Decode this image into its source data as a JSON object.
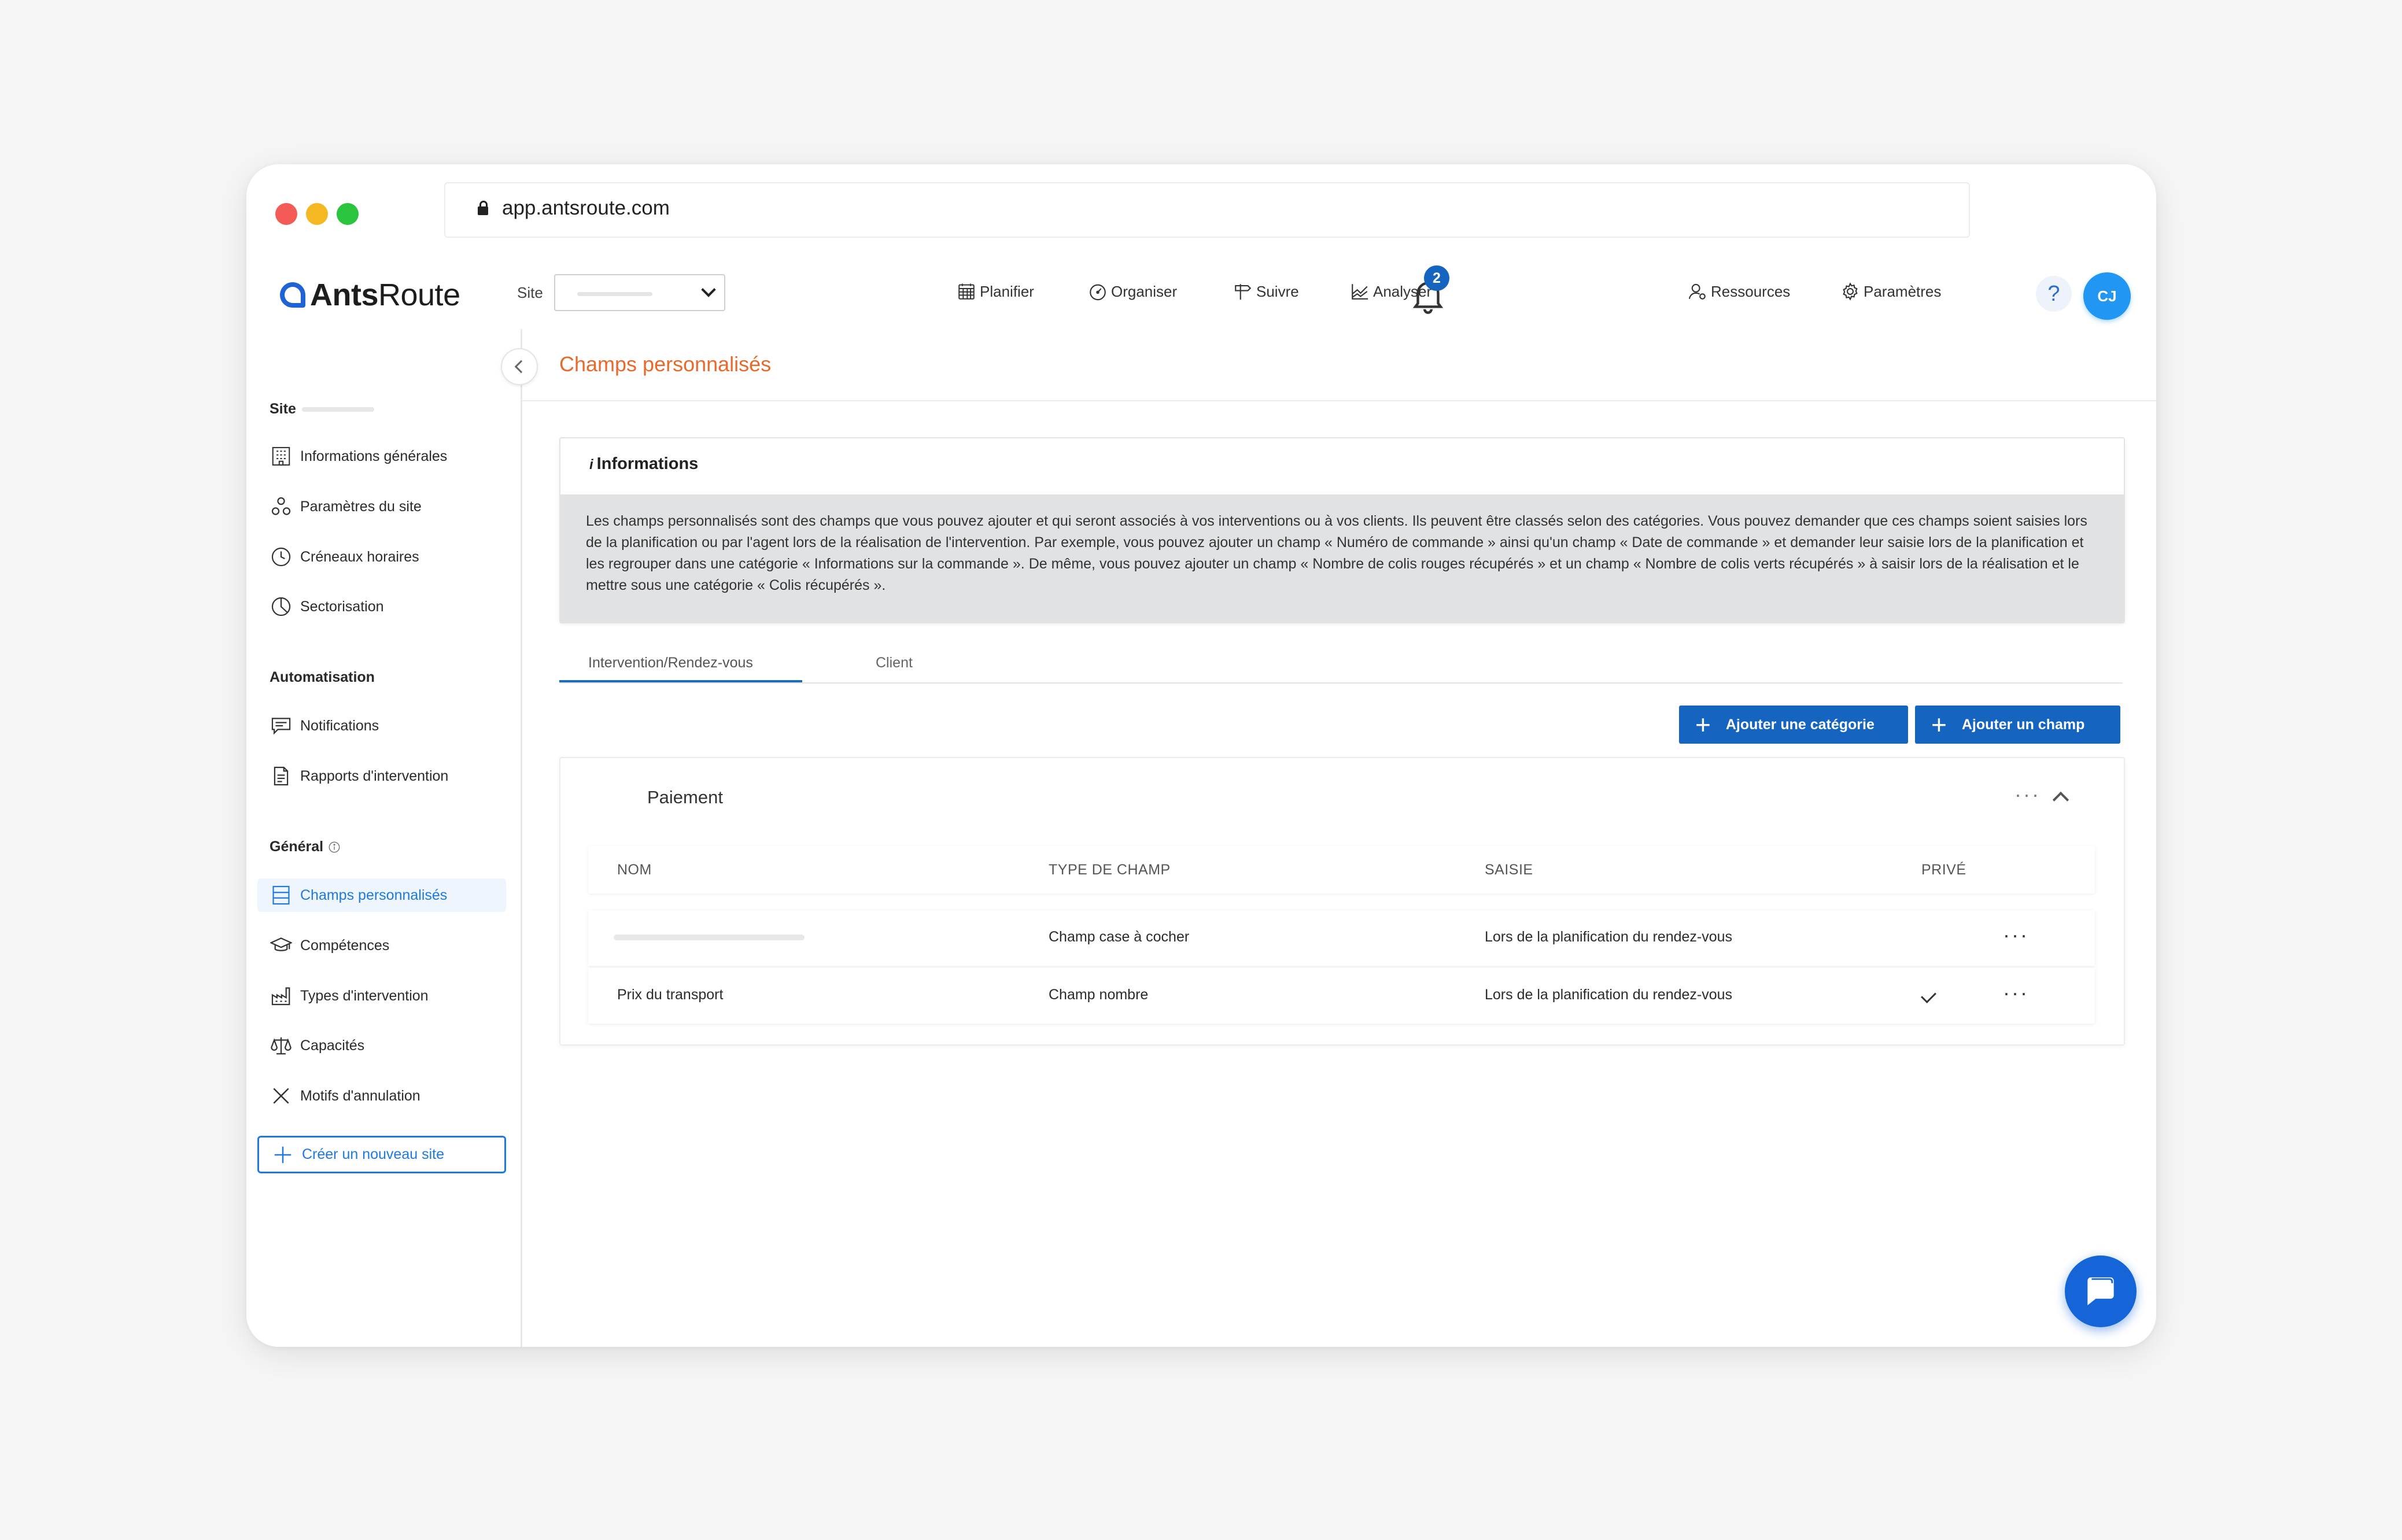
{
  "browser": {
    "url": "app.antsroute.com"
  },
  "navbar": {
    "logo_bold": "Ants",
    "logo_light": "Route",
    "site_label": "Site",
    "menu": [
      {
        "label": "Planifier",
        "icon": "calendar-icon"
      },
      {
        "label": "Organiser",
        "icon": "gauge-icon"
      },
      {
        "label": "Suivre",
        "icon": "signpost-icon"
      },
      {
        "label": "Analyser",
        "icon": "chart-icon"
      }
    ],
    "right_menu": [
      {
        "label": "Ressources",
        "icon": "user-gear-icon"
      },
      {
        "label": "Paramètres",
        "icon": "gear-icon"
      }
    ],
    "notifications_count": "2",
    "help": "?",
    "avatar_initials": "CJ"
  },
  "sidebar": {
    "section_site": "Site",
    "site_items": [
      {
        "label": "Informations générales",
        "icon": "building-icon"
      },
      {
        "label": "Paramètres du site",
        "icon": "nodes-icon"
      },
      {
        "label": "Créneaux horaires",
        "icon": "clock-icon"
      },
      {
        "label": "Sectorisation",
        "icon": "pie-icon"
      }
    ],
    "section_automation": "Automatisation",
    "automation_items": [
      {
        "label": "Notifications",
        "icon": "message-icon"
      },
      {
        "label": "Rapports d'intervention",
        "icon": "document-icon"
      }
    ],
    "section_general": "Général",
    "general_items": [
      {
        "label": "Champs personnalisés",
        "icon": "list-icon"
      },
      {
        "label": "Compétences",
        "icon": "graduation-cap-icon"
      },
      {
        "label": "Types d'intervention",
        "icon": "factory-icon"
      },
      {
        "label": "Capacités",
        "icon": "scale-icon"
      },
      {
        "label": "Motifs d'annulation",
        "icon": "cross-icon"
      }
    ],
    "create_site": "Créer un nouveau site"
  },
  "main": {
    "page_title": "Champs personnalisés",
    "info": {
      "title": "Informations",
      "text": "Les champs personnalisés sont des champs que vous pouvez ajouter et qui seront associés à vos interventions ou à vos clients. Ils peuvent être classés selon des catégories. Vous pouvez demander que ces champs soient saisies lors de la planification ou par l'agent lors de la réalisation de l'intervention. Par exemple, vous pouvez ajouter un champ « Numéro de commande » ainsi qu'un champ « Date de commande » et demander leur saisie lors de la planification et les regrouper dans une catégorie « Informations sur la commande ». De même, vous pouvez ajouter un champ « Nombre de colis rouges récupérés » et un champ « Nombre de colis verts récupérés » à saisir lors de la réalisation et le mettre sous une catégorie « Colis récupérés »."
    },
    "tabs": [
      {
        "label": "Intervention/Rendez-vous"
      },
      {
        "label": "Client"
      }
    ],
    "buttons": {
      "add_category": "Ajouter une catégorie",
      "add_field": "Ajouter un champ"
    },
    "category": {
      "title": "Paiement",
      "columns": [
        "NOM",
        "TYPE DE CHAMP",
        "SAISIE",
        "PRIVÉ"
      ],
      "rows": [
        {
          "name": "",
          "type": "Champ case à cocher",
          "saisie": "Lors de la planification du rendez-vous",
          "private": false
        },
        {
          "name": "Prix du transport",
          "type": "Champ nombre",
          "saisie": "Lors de la planification du rendez-vous",
          "private": true
        }
      ]
    }
  }
}
